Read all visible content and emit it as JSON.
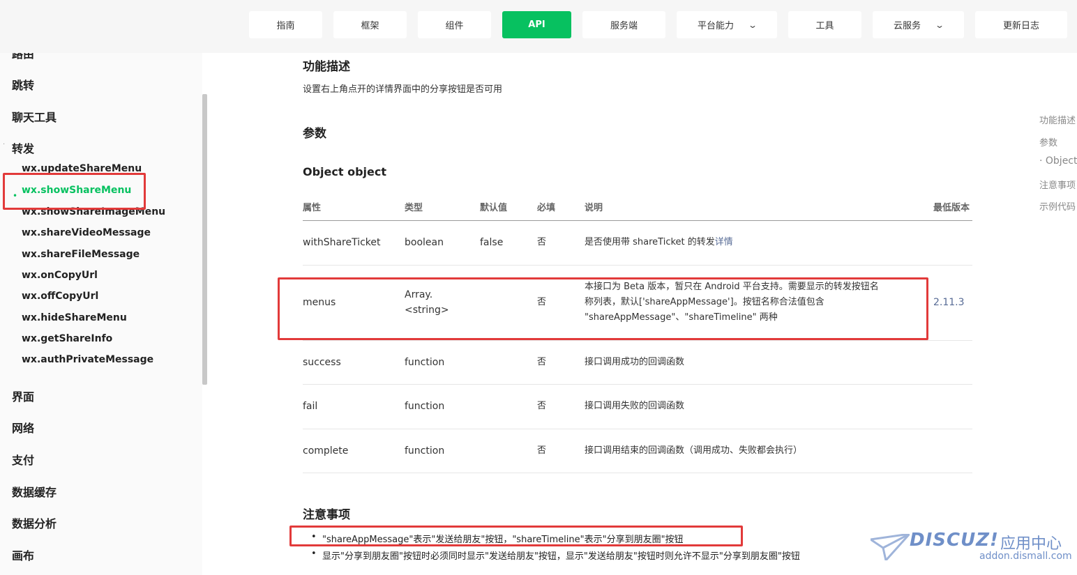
{
  "topnav": {
    "items": [
      {
        "label": "指南"
      },
      {
        "label": "框架"
      },
      {
        "label": "组件"
      },
      {
        "label": "API"
      },
      {
        "label": "服务端"
      },
      {
        "label": "平台能力"
      },
      {
        "label": "工具"
      },
      {
        "label": "云服务"
      },
      {
        "label": "更新日志"
      }
    ],
    "active": "API"
  },
  "sidebar": {
    "categories": [
      "路由",
      "跳转",
      "聊天工具",
      "转发",
      "界面",
      "网络",
      "支付",
      "数据缓存",
      "数据分析",
      "画布"
    ],
    "expanded_marker": "·",
    "subitems": [
      "wx.updateShareMenu",
      "wx.showShareMenu",
      "wx.showShareImageMenu",
      "wx.shareVideoMessage",
      "wx.shareFileMessage",
      "wx.onCopyUrl",
      "wx.offCopyUrl",
      "wx.hideShareMenu",
      "wx.getShareInfo",
      "wx.authPrivateMessage"
    ],
    "active_bullet": "•"
  },
  "main": {
    "section_desc_title": "功能描述",
    "section_desc_text": "设置右上角点开的详情界面中的分享按钮是否可用",
    "params_title": "参数",
    "object_title": "Object object",
    "table": {
      "headers": [
        "属性",
        "类型",
        "默认值",
        "必填",
        "说明",
        "最低版本"
      ],
      "rows": [
        {
          "attr": "withShareTicket",
          "type": "boolean",
          "default": "false",
          "required": "否",
          "desc": "是否使用带 shareTicket 的转发",
          "desc_link": "详情",
          "version": ""
        },
        {
          "attr": "menus",
          "type_line1": "Array.",
          "type_line2": "<string>",
          "default": "",
          "required": "否",
          "desc_line1": "本接口为 Beta 版本，暂只在 Android 平台支持。需要显示的转发按钮名",
          "desc_line2": "称列表，默认['shareAppMessage']。按钮名称合法值包含",
          "desc_line3": "\"shareAppMessage\"、\"shareTimeline\" 两种",
          "version": "2.11.3"
        },
        {
          "attr": "success",
          "type": "function",
          "default": "",
          "required": "否",
          "desc": "接口调用成功的回调函数",
          "version": ""
        },
        {
          "attr": "fail",
          "type": "function",
          "default": "",
          "required": "否",
          "desc": "接口调用失败的回调函数",
          "version": ""
        },
        {
          "attr": "complete",
          "type": "function",
          "default": "",
          "required": "否",
          "desc": "接口调用结束的回调函数（调用成功、失败都会执行）",
          "version": ""
        }
      ]
    },
    "notes_title": "注意事项",
    "notes": [
      "\"shareAppMessage\"表示\"发送给朋友\"按钮，\"shareTimeline\"表示\"分享到朋友圈\"按钮",
      "显示\"分享到朋友圈\"按钮时必须同时显示\"发送给朋友\"按钮，显示\"发送给朋友\"按钮时则允许不显示\"分享到朋友圈\"按钮"
    ],
    "bullet": "•"
  },
  "toc": {
    "items": [
      "功能描述",
      "参数",
      "· Object",
      "注意事项",
      "示例代码"
    ]
  },
  "watermark": {
    "logo": "DISCUZ!",
    "cn": "应用中心",
    "url": "addon.dismall.com"
  },
  "colors": {
    "accent": "#07c160",
    "annotation": "#e23a3a",
    "link": "#576b95"
  },
  "icons": {
    "dropdown": "chevron-down-icon"
  }
}
